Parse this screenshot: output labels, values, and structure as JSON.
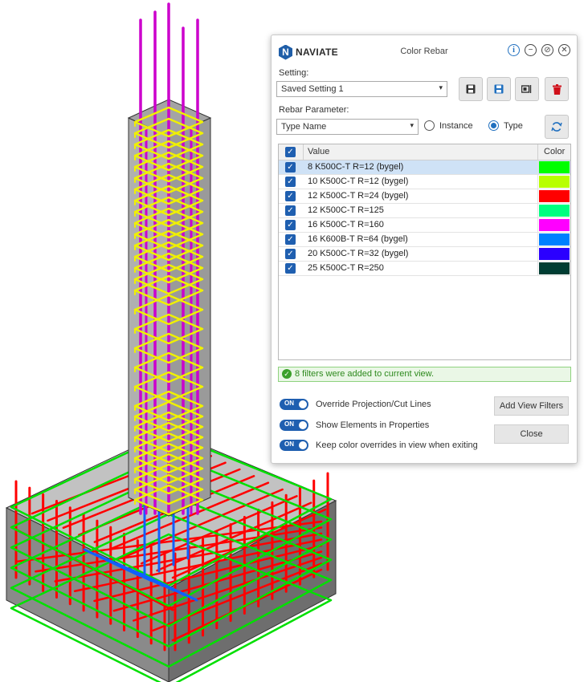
{
  "window": {
    "brand": "NAVIATE",
    "title": "Color Rebar",
    "controls": [
      "info-icon",
      "minimize-icon",
      "pin-icon",
      "close-icon"
    ]
  },
  "setting": {
    "label": "Setting:",
    "selected": "Saved Setting 1",
    "buttons": [
      "save-icon",
      "save-as-icon",
      "rename-icon",
      "delete-icon"
    ]
  },
  "rebar_parameter": {
    "label": "Rebar Parameter:",
    "selected": "Type Name",
    "radio_instance": "Instance",
    "radio_type": "Type",
    "selected_radio": "Type"
  },
  "table": {
    "columns": [
      "Value",
      "Color"
    ],
    "rows": [
      {
        "value": "8 K500C-T R=12 (bygel)",
        "color": "#00ff00",
        "checked": true,
        "selected": true
      },
      {
        "value": "10 K500C-T R=12 (bygel)",
        "color": "#b8ff00",
        "checked": true,
        "selected": false
      },
      {
        "value": "12 K500C-T R=24 (bygel)",
        "color": "#ff0000",
        "checked": true,
        "selected": false
      },
      {
        "value": "12 K500C-T R=125",
        "color": "#00ff80",
        "checked": true,
        "selected": false
      },
      {
        "value": "16 K500C-T R=160",
        "color": "#ff00ff",
        "checked": true,
        "selected": false
      },
      {
        "value": "16 K600B-T R=64 (bygel)",
        "color": "#0080ff",
        "checked": true,
        "selected": false
      },
      {
        "value": "20 K500C-T R=32 (bygel)",
        "color": "#2b00ff",
        "checked": true,
        "selected": false
      },
      {
        "value": "25 K500C-T R=250",
        "color": "#003d33",
        "checked": true,
        "selected": false
      }
    ]
  },
  "status": "8 filters were added to current view.",
  "toggles": {
    "on_label": "ON",
    "items": [
      "Override Projection/Cut Lines",
      "Show Elements in Properties",
      "Keep color overrides in view when exiting"
    ]
  },
  "buttons": {
    "add_view_filters": "Add View Filters",
    "close": "Close"
  },
  "colors": {
    "accent": "#1f5fb0",
    "stirrup": "#f0f000",
    "vertical_bar": "#cc00cc",
    "footing_bar": "#ff0000",
    "footing_tie": "#00e000",
    "dowel": "#1060ff",
    "concrete": "#a7a7a7"
  }
}
